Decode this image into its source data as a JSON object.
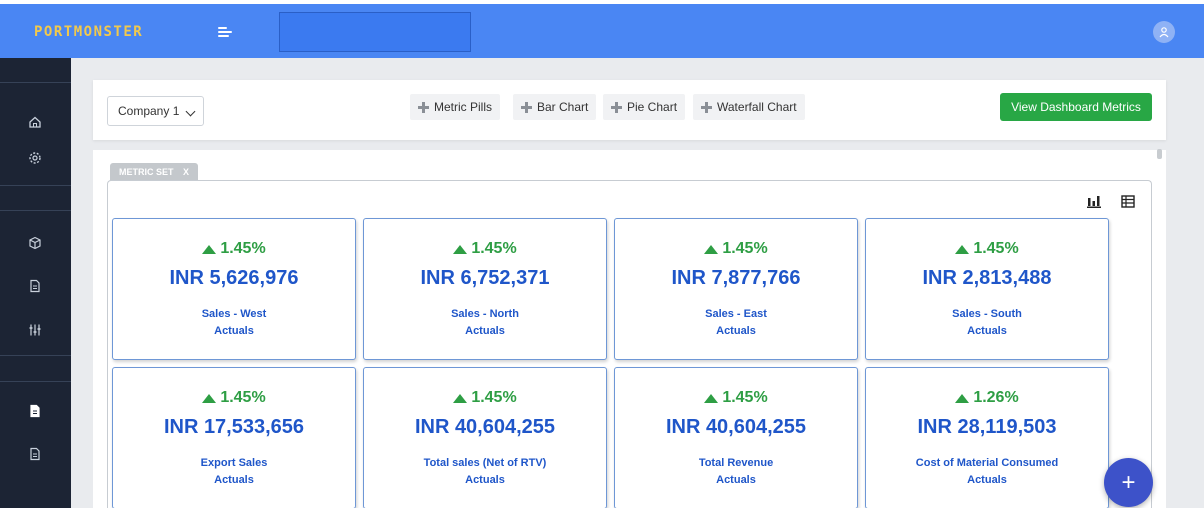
{
  "app": {
    "logo_text": "PORTMONSTER"
  },
  "header": {
    "company_selected": "Company 1",
    "add_buttons": [
      "Metric Pills",
      "Bar Chart",
      "Pie Chart",
      "Waterfall Chart"
    ],
    "view_dashboard_label": "View Dashboard Metrics"
  },
  "metric_set": {
    "tag_label": "METRIC SET",
    "close_label": "X",
    "metrics": [
      {
        "change": "1.45%",
        "value": "INR 5,626,976",
        "label": "Sales - West",
        "sub": "Actuals"
      },
      {
        "change": "1.45%",
        "value": "INR 6,752,371",
        "label": "Sales - North",
        "sub": "Actuals"
      },
      {
        "change": "1.45%",
        "value": "INR 7,877,766",
        "label": "Sales - East",
        "sub": "Actuals"
      },
      {
        "change": "1.45%",
        "value": "INR 2,813,488",
        "label": "Sales - South",
        "sub": "Actuals"
      },
      {
        "change": "1.45%",
        "value": "INR 17,533,656",
        "label": "Export Sales",
        "sub": "Actuals"
      },
      {
        "change": "1.45%",
        "value": "INR 40,604,255",
        "label": "Total sales (Net of RTV)",
        "sub": "Actuals"
      },
      {
        "change": "1.45%",
        "value": "INR 40,604,255",
        "label": "Total Revenue",
        "sub": "Actuals"
      },
      {
        "change": "1.26%",
        "value": "INR 28,119,503",
        "label": "Cost of Material Consumed",
        "sub": "Actuals"
      }
    ]
  },
  "fab_label": "+",
  "colors": {
    "topbar": "#4a86f3",
    "sidebar": "#1c2434",
    "accent_green": "#28a745",
    "metric_blue": "#1f56c9",
    "positive": "#2e9e44",
    "fab": "#3d52c9"
  },
  "icons": {
    "sidebar": [
      "home-icon",
      "gear-icon",
      "cube-icon",
      "document-icon",
      "sliders-icon",
      "document-icon",
      "document-icon"
    ],
    "view_toggle": [
      "bar-chart-icon",
      "table-icon"
    ]
  }
}
